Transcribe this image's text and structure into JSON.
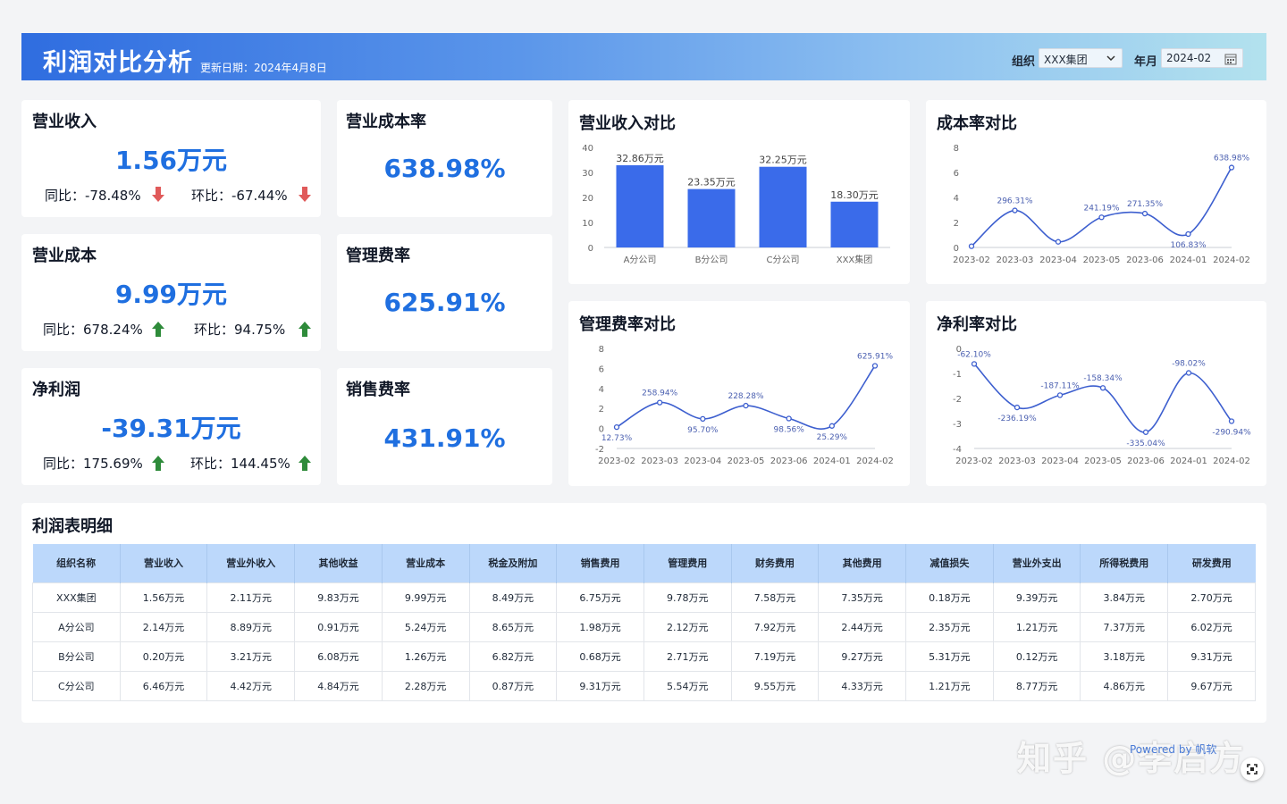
{
  "header": {
    "title": "利润对比分析",
    "updated": "更新日期：2024年4月8日",
    "org_label": "组织",
    "org_value": "XXX集团",
    "month_label": "年月",
    "month_value": "2024-02"
  },
  "kpis": {
    "revenue": {
      "title": "营业收入",
      "value": "1.56万元",
      "yoy": "同比：-78.48%",
      "mom": "环比：-67.44%",
      "yoy_dir": "down",
      "mom_dir": "down"
    },
    "cost": {
      "title": "营业成本",
      "value": "9.99万元",
      "yoy": "同比：678.24%",
      "mom": "环比：94.75%",
      "yoy_dir": "up",
      "mom_dir": "up"
    },
    "profit": {
      "title": "净利润",
      "value": "-39.31万元",
      "yoy": "同比：175.69%",
      "mom": "环比：144.45%",
      "yoy_dir": "up",
      "mom_dir": "up"
    },
    "cost_rate": {
      "title": "营业成本率",
      "value": "638.98%"
    },
    "mgmt_rate": {
      "title": "管理费率",
      "value": "625.91%"
    },
    "sales_rate": {
      "title": "销售费率",
      "value": "431.91%"
    }
  },
  "colors": {
    "accent": "#1f6fe0",
    "bar": "#3a6bea",
    "line": "#3d5fcf",
    "up": "#2e8b3a",
    "down": "#e05a5a",
    "header_th": "#bcd8fb"
  },
  "chart_data": [
    {
      "id": "revenue_compare",
      "type": "bar",
      "title": "营业收入对比",
      "categories": [
        "A分公司",
        "B分公司",
        "C分公司",
        "XXX集团"
      ],
      "values": [
        32.86,
        23.35,
        32.25,
        18.3
      ],
      "labels": [
        "32.86万元",
        "23.35万元",
        "32.25万元",
        "18.30万元"
      ],
      "yticks": [
        "40",
        "30",
        "20",
        "10",
        "0"
      ],
      "ylim": [
        0,
        40
      ]
    },
    {
      "id": "cost_rate_compare",
      "type": "line",
      "title": "成本率对比",
      "categories": [
        "2023-02",
        "2023-03",
        "2023-04",
        "2023-05",
        "2023-06",
        "2024-01",
        "2024-02"
      ],
      "values": [
        0.1,
        2.96,
        0.45,
        2.41,
        2.71,
        1.07,
        6.39
      ],
      "labels": [
        "",
        "296.31%",
        "",
        "241.19%",
        "271.35%",
        "106.83%",
        "638.98%"
      ],
      "yticks": [
        "8",
        "6",
        "4",
        "2",
        "0"
      ],
      "ylim": [
        0,
        8
      ]
    },
    {
      "id": "mgmt_rate_compare",
      "type": "line",
      "title": "管理费率对比",
      "categories": [
        "2023-02",
        "2023-03",
        "2023-04",
        "2023-05",
        "2023-06",
        "2024-01",
        "2024-02"
      ],
      "values": [
        0.13,
        2.59,
        0.96,
        2.28,
        0.99,
        0.25,
        6.26
      ],
      "labels": [
        "12.73%",
        "258.94%",
        "95.70%",
        "228.28%",
        "98.56%",
        "25.29%",
        "625.91%"
      ],
      "yticks": [
        "8",
        "6",
        "4",
        "2",
        "0",
        "-2"
      ],
      "ylim": [
        -2,
        8
      ]
    },
    {
      "id": "net_margin_compare",
      "type": "line",
      "title": "净利率对比",
      "categories": [
        "2023-02",
        "2023-03",
        "2023-04",
        "2023-05",
        "2023-06",
        "2024-01",
        "2024-02"
      ],
      "values": [
        -0.62,
        -2.36,
        -1.87,
        -1.58,
        -3.35,
        -0.98,
        -2.91
      ],
      "labels": [
        "-62.10%",
        "-236.19%",
        "-187.11%",
        "-158.34%",
        "-335.04%",
        "-98.02%",
        "-290.94%"
      ],
      "yticks": [
        "0",
        "-1",
        "-2",
        "-3",
        "-4"
      ],
      "ylim": [
        -4,
        0
      ]
    }
  ],
  "table": {
    "title": "利润表明细",
    "headers": [
      "组织名称",
      "营业收入",
      "营业外收入",
      "其他收益",
      "营业成本",
      "税金及附加",
      "销售费用",
      "管理费用",
      "财务费用",
      "其他费用",
      "减值损失",
      "营业外支出",
      "所得税费用",
      "研发费用"
    ],
    "rows": [
      [
        "XXX集团",
        "1.56万元",
        "2.11万元",
        "9.83万元",
        "9.99万元",
        "8.49万元",
        "6.75万元",
        "9.78万元",
        "7.58万元",
        "7.35万元",
        "0.18万元",
        "9.39万元",
        "3.84万元",
        "2.70万元"
      ],
      [
        "A分公司",
        "2.14万元",
        "8.89万元",
        "0.91万元",
        "5.24万元",
        "8.65万元",
        "1.98万元",
        "2.12万元",
        "7.92万元",
        "2.44万元",
        "2.35万元",
        "1.21万元",
        "7.37万元",
        "6.02万元"
      ],
      [
        "B分公司",
        "0.20万元",
        "3.21万元",
        "6.08万元",
        "1.26万元",
        "6.82万元",
        "0.68万元",
        "2.71万元",
        "7.19万元",
        "9.27万元",
        "5.31万元",
        "0.12万元",
        "3.18万元",
        "9.31万元"
      ],
      [
        "C分公司",
        "6.46万元",
        "4.42万元",
        "4.84万元",
        "2.28万元",
        "0.87万元",
        "9.31万元",
        "5.54万元",
        "9.55万元",
        "4.33万元",
        "1.21万元",
        "8.77万元",
        "4.86万元",
        "9.67万元"
      ]
    ]
  },
  "footer": {
    "watermark": "知乎 @李启方",
    "powered": "Powered by 帆软"
  }
}
